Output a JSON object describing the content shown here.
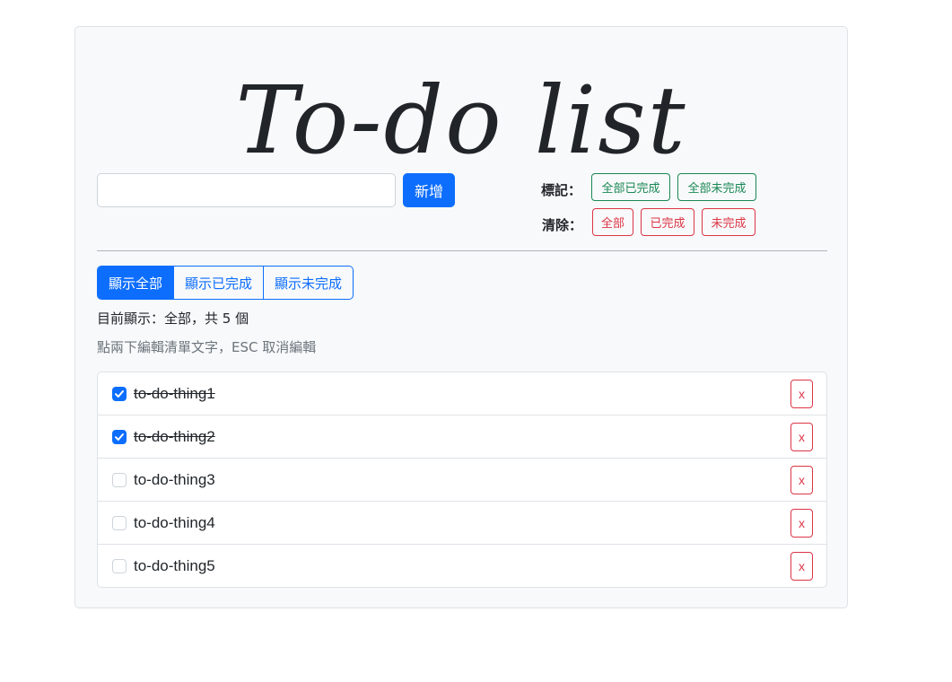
{
  "header": {
    "title": "To-do list"
  },
  "add": {
    "input_value": "",
    "button_label": "新增"
  },
  "mark": {
    "label": "標記：",
    "all_done": "全部已完成",
    "all_undone": "全部未完成"
  },
  "clear": {
    "label": "清除：",
    "all": "全部",
    "done": "已完成",
    "undone": "未完成"
  },
  "filters": [
    {
      "label": "顯示全部",
      "active": true
    },
    {
      "label": "顯示已完成",
      "active": false
    },
    {
      "label": "顯示未完成",
      "active": false
    }
  ],
  "status_text": "目前顯示：全部，共 5 個",
  "hint_text": "點兩下編輯清單文字，ESC 取消編輯",
  "items": [
    {
      "text": "to-do-thing1",
      "done": true,
      "delete_label": "x"
    },
    {
      "text": "to-do-thing2",
      "done": true,
      "delete_label": "x"
    },
    {
      "text": "to-do-thing3",
      "done": false,
      "delete_label": "x"
    },
    {
      "text": "to-do-thing4",
      "done": false,
      "delete_label": "x"
    },
    {
      "text": "to-do-thing5",
      "done": false,
      "delete_label": "x"
    }
  ],
  "colors": {
    "primary": "#0d6efd",
    "success": "#198754",
    "danger": "#dc3545",
    "card_bg": "#f8f9fa"
  }
}
